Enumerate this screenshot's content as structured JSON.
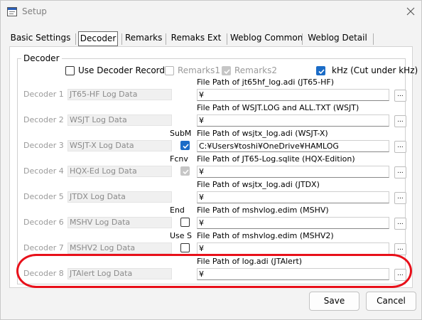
{
  "window": {
    "title": "Setup"
  },
  "tabs": [
    {
      "label": "Basic Settings"
    },
    {
      "label": "Decoder",
      "selected": true
    },
    {
      "label": "Remarks"
    },
    {
      "label": "Remaks Ext"
    },
    {
      "label": "Weblog Common"
    },
    {
      "label": "Weblog Detail"
    }
  ],
  "group_title": "Decoder",
  "options": {
    "use_decoder_record": {
      "label": "Use Decoder Record",
      "checked": false
    },
    "remarks1": {
      "label": "Remarks1",
      "checked": false,
      "disabled": true
    },
    "remarks2": {
      "label": "Remarks2",
      "checked": true,
      "disabled": true
    },
    "khz": {
      "label": "kHz (Cut under kHz)",
      "checked": true
    }
  },
  "decoders": [
    {
      "name": "Decoder 1",
      "log": "JT65-HF Log Data",
      "path_label": "File Path of jt65hf_log.adi (JT65-HF)",
      "path": "¥"
    },
    {
      "name": "Decoder 2",
      "log": "WSJT Log Data",
      "path_label": "File Path of WSJT.LOG and ALL.TXT (WSJT)",
      "path": "¥"
    },
    {
      "name": "Decoder 3",
      "log": "WSJT-X Log Data",
      "side_label": "SubM",
      "checkbox": "on",
      "path_label": "File Path of wsjtx_log.adi (WSJT-X)",
      "path": "C:¥Users¥toshi¥OneDrive¥HAMLOG"
    },
    {
      "name": "Decoder 4",
      "log": "HQX-Ed Log Data",
      "side_label": "Fcnv",
      "checkbox": "on-dis",
      "path_label": "File Path of JT65-Log.sqlite (HQX-Edition)",
      "path": "¥"
    },
    {
      "name": "Decoder 5",
      "log": "JTDX Log Data",
      "path_label": "File Path of wsjtx_log.adi (JTDX)",
      "path": "¥"
    },
    {
      "name": "Decoder 6",
      "log": "MSHV Log Data",
      "side_label": "End",
      "checkbox": "off",
      "path_label": "File Path of mshvlog.edim (MSHV)",
      "path": "¥"
    },
    {
      "name": "Decoder 7",
      "log": "MSHV2 Log Data",
      "side_label": "Use S",
      "checkbox": "off",
      "path_label": "File Path of mshvlog.edim (MSHV2)",
      "path": "¥"
    },
    {
      "name": "Decoder 8",
      "log": "JTAlert Log Data",
      "path_label": "File Path of log.adi (JTAlert)",
      "path": "¥"
    }
  ],
  "browse_label": "...",
  "buttons": {
    "save": "Save",
    "cancel": "Cancel"
  },
  "colors": {
    "accent": "#1b6cc7",
    "highlight": "#e8101a"
  }
}
